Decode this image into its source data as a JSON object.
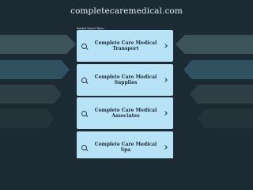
{
  "header": {
    "domain": "completecaremedical.com"
  },
  "related": {
    "label": "Related Search Topics"
  },
  "cards": [
    {
      "label": "Complete Care Medical Transport",
      "icon": "search-icon",
      "chevron": "chevron-right-icon"
    },
    {
      "label": "Complete Care Medical Supplies",
      "icon": "search-icon",
      "chevron": "chevron-right-icon"
    },
    {
      "label": "Complete Care Medical Associates",
      "icon": "search-icon",
      "chevron": "chevron-right-icon"
    },
    {
      "label": "Complete Care Medical Spa",
      "icon": "search-icon",
      "chevron": "chevron-right-icon"
    }
  ],
  "colors": {
    "background": "#1c2a33",
    "card": "#b8e3f6",
    "card_text": "#1d2a33",
    "header_text": "#e6edf2"
  }
}
